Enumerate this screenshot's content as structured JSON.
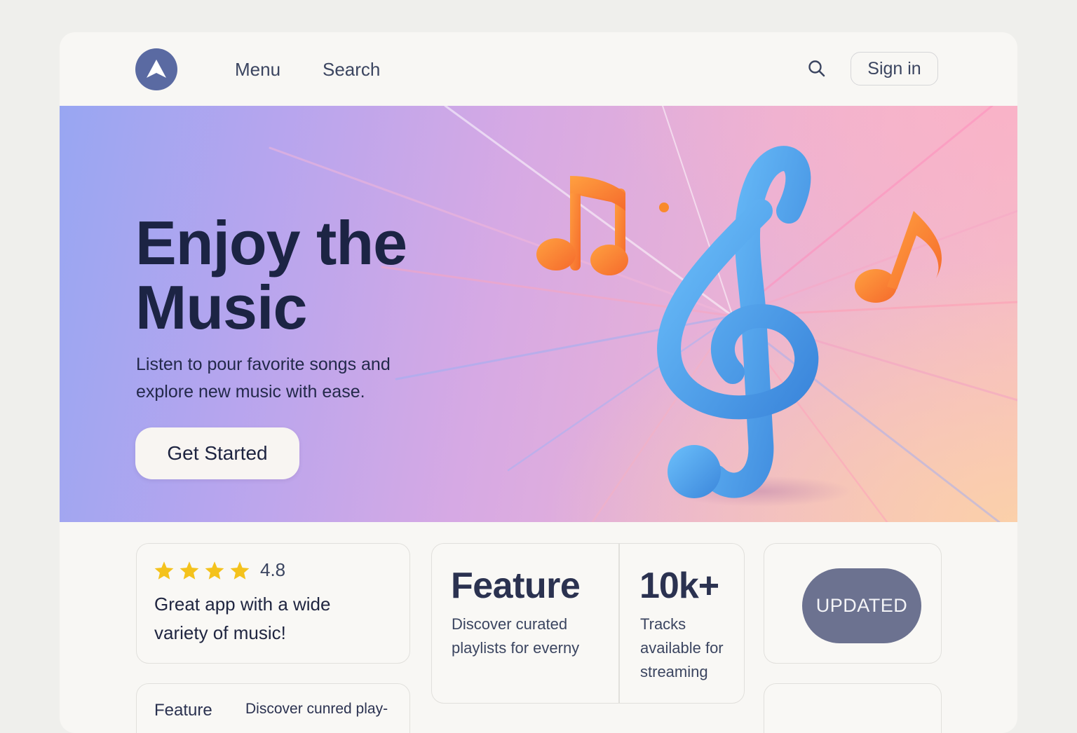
{
  "header": {
    "nav": [
      {
        "label": "Menu"
      },
      {
        "label": "Search"
      }
    ],
    "signin_label": "Sign in"
  },
  "hero": {
    "title_line1": "Enjoy the",
    "title_line2": "Music",
    "subtitle_line1": "Listen to pour favorite songs and",
    "subtitle_line2": "explore new music with ease.",
    "cta_label": "Get Started"
  },
  "review_card": {
    "stars": 4,
    "rating": "4.8",
    "text_line1": "Great app with a wide",
    "text_line2": "variety of music!"
  },
  "feature_card": {
    "title": "Feature",
    "text_line1": "Discover curated",
    "text_line2": "playlists for everny",
    "stat_value": "10k+",
    "stat_line1": "Tracks",
    "stat_line2": "available for",
    "stat_line3": "streaming"
  },
  "badge_card": {
    "label": "UPDATED"
  },
  "feature_row": {
    "label": "Feature",
    "text": "Discover cunred play-"
  },
  "colors": {
    "brand": "#5a6aa2",
    "heading": "#1c2444",
    "star": "#f4c21c",
    "badge": "#6c7290",
    "note_orange": "#f98a2c",
    "clef_blue": "#4a9fe8"
  },
  "icons": [
    "logo-icon",
    "search-icon",
    "star-icon",
    "treble-clef-icon",
    "music-note-icon"
  ]
}
